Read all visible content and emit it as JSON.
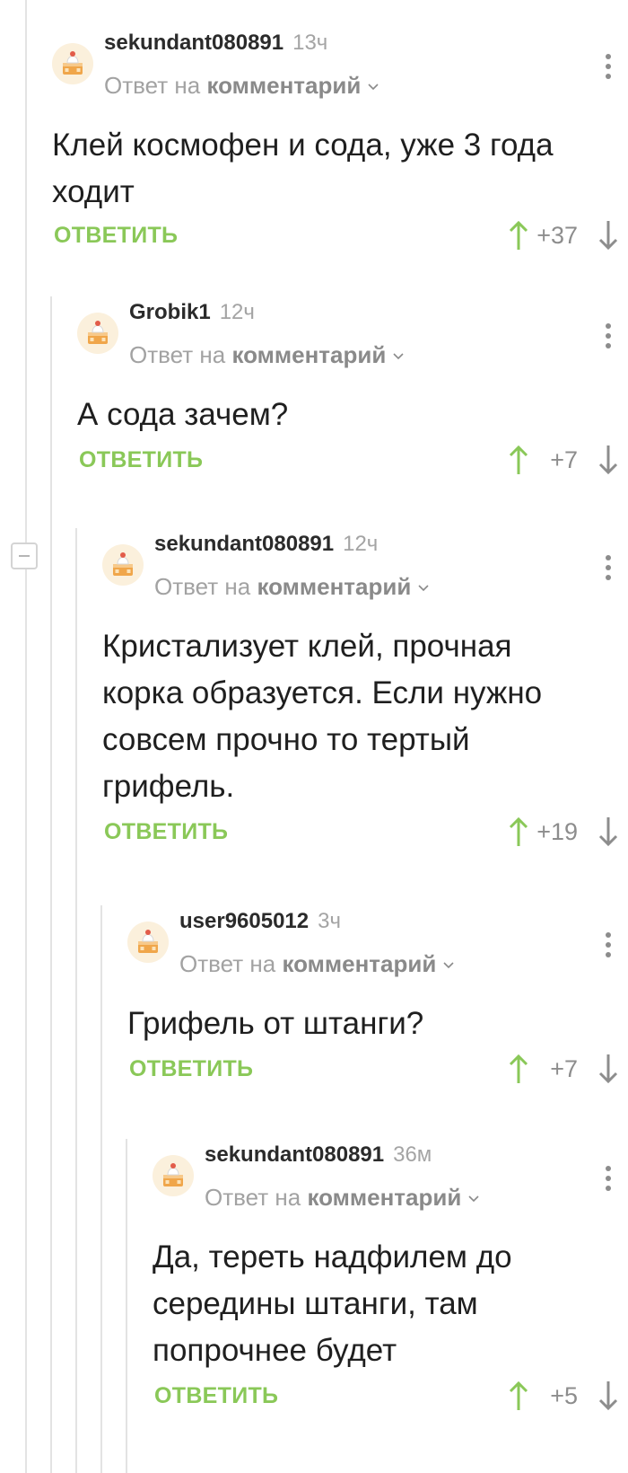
{
  "comments": [
    {
      "username": "sekundant080891",
      "time_ago": "13ч",
      "reply_prefix": "Ответ на",
      "reply_link": "комментарий",
      "text": "Клей космофен и сода, уже 3 года ходит",
      "reply_label": "ОТВЕТИТЬ",
      "rating": "+37"
    },
    {
      "username": "Grobik1",
      "time_ago": "12ч",
      "reply_prefix": "Ответ на",
      "reply_link": "комментарий",
      "text": "А сода зачем?",
      "reply_label": "ОТВЕТИТЬ",
      "rating": "+7"
    },
    {
      "username": "sekundant080891",
      "time_ago": "12ч",
      "reply_prefix": "Ответ на",
      "reply_link": "комментарий",
      "text": "Кристализует клей, прочная корка образуется. Если нужно совсем прочно то тертый грифель.",
      "reply_label": "ОТВЕТИТЬ",
      "rating": "+19"
    },
    {
      "username": "user9605012",
      "time_ago": "3ч",
      "reply_prefix": "Ответ на",
      "reply_link": "комментарий",
      "text": "Грифель от штанги?",
      "reply_label": "ОТВЕТИТЬ",
      "rating": "+7"
    },
    {
      "username": "sekundant080891",
      "time_ago": "36м",
      "reply_prefix": "Ответ на",
      "reply_link": "комментарий",
      "text": "Да, тереть надфилем до середины штанги, там попрочнее будет",
      "reply_label": "ОТВЕТИТЬ",
      "rating": "+5"
    }
  ],
  "icons": {
    "avatar": "default-avatar-cake-icon",
    "more": "more-vertical-icon",
    "upvote": "arrow-up-icon",
    "downvote": "arrow-down-icon",
    "expand": "chevron-down-icon",
    "collapse": "minus-icon"
  },
  "colors": {
    "accent_green": "#8ac858",
    "text": "#1f1f1f",
    "muted": "#a2a2a2",
    "thread_line": "#e3e3e3"
  }
}
